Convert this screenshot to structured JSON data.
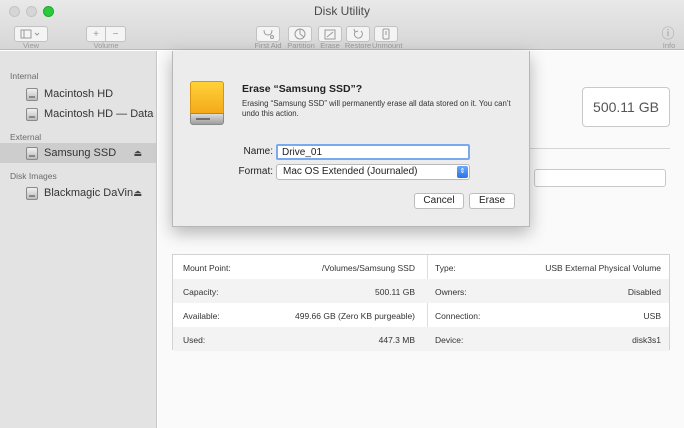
{
  "window": {
    "title": "Disk Utility"
  },
  "toolbar": {
    "view_label": "View",
    "volume_label": "Volume",
    "first_aid_label": "First Aid",
    "partition_label": "Partition",
    "erase_label": "Erase",
    "restore_label": "Restore",
    "unmount_label": "Unmount",
    "info_label": "Info",
    "add_glyph": "+",
    "remove_glyph": "−",
    "info_glyph": "ⓘ"
  },
  "sidebar": {
    "sections": [
      {
        "header": "Internal",
        "items": [
          {
            "label": "Macintosh HD"
          },
          {
            "label": "Macintosh HD — Data"
          }
        ]
      },
      {
        "header": "External",
        "items": [
          {
            "label": "Samsung SSD",
            "selected": true,
            "eject": true
          }
        ]
      },
      {
        "header": "Disk Images",
        "items": [
          {
            "label": "Blackmagic DaVin...",
            "eject": true
          }
        ]
      }
    ],
    "eject_glyph": "⏏"
  },
  "main": {
    "capacity_display": "500.11 GB",
    "info": {
      "rows": [
        {
          "label1": "Mount Point:",
          "value1": "/Volumes/Samsung SSD",
          "label2": "Type:",
          "value2": "USB External Physical Volume"
        },
        {
          "label1": "Capacity:",
          "value1": "500.11 GB",
          "label2": "Owners:",
          "value2": "Disabled"
        },
        {
          "label1": "Available:",
          "value1": "499.66 GB (Zero KB purgeable)",
          "label2": "Connection:",
          "value2": "USB"
        },
        {
          "label1": "Used:",
          "value1": "447.3 MB",
          "label2": "Device:",
          "value2": "disk3s1"
        }
      ]
    }
  },
  "dialog": {
    "title": "Erase “Samsung SSD”?",
    "message": "Erasing “Samsung SSD” will permanently erase all data stored on it. You can’t undo this action.",
    "name_label": "Name:",
    "name_value": "Drive_01",
    "format_label": "Format:",
    "format_value": "Mac OS Extended (Journaled)",
    "cancel_label": "Cancel",
    "erase_label": "Erase"
  }
}
